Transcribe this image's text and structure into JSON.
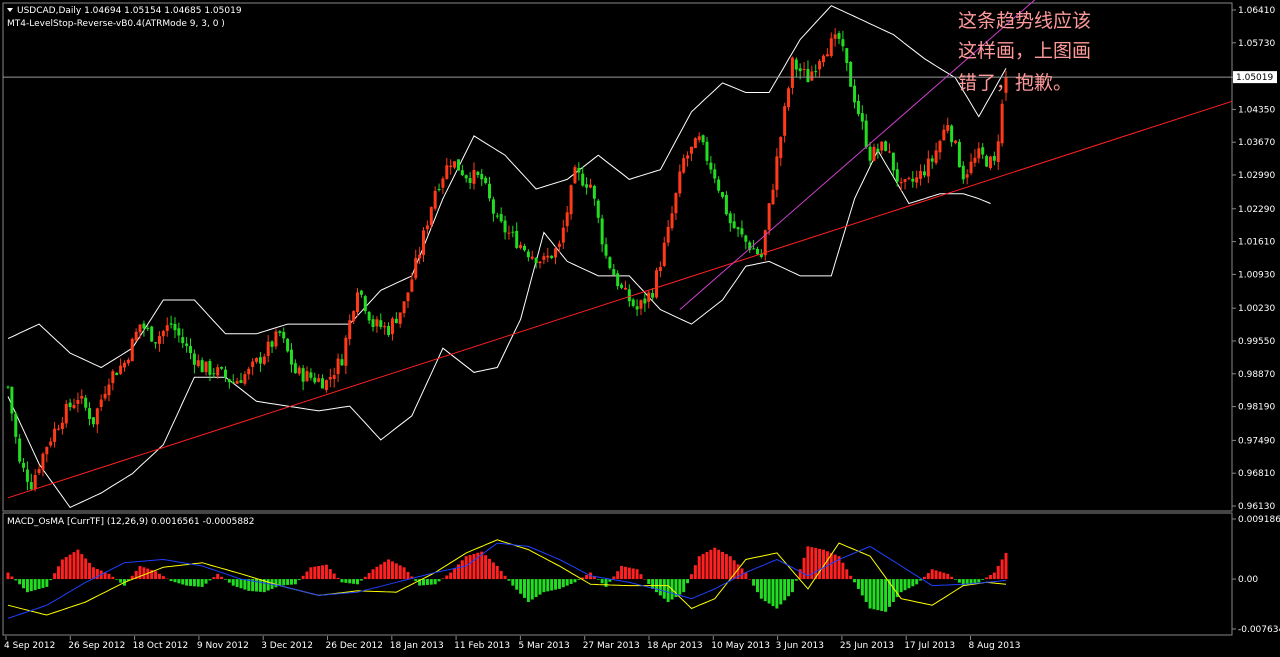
{
  "main_header": {
    "symbol_info": "USDCAD,Daily  1.04694 1.05154 1.04685 1.05019",
    "indicator_label": "MT4-LevelStop-Reverse-vB0.4(ATRMode 9, 3, 0 )"
  },
  "annotation": {
    "lines": [
      "这条趋势线应该",
      "这样画，上图画",
      "错了，抱歉。"
    ]
  },
  "macd_header": {
    "label": "MACD_OsMA [CurrTF] (12,26,9) 0.0016561 -0.0005882"
  },
  "colors": {
    "background": "#000000",
    "grid": "#ffffff",
    "bull_candle": "#ff3a1a",
    "bear_candle": "#22dd22",
    "bollinger": "#ffffff",
    "trendline_red": "#ff2020",
    "trendline_magenta": "#d040d0",
    "macd_pos": "#ff2020",
    "macd_neg": "#22dd22",
    "signal_yellow": "#ffff00",
    "signal_blue": "#2040ff",
    "annotation": "#ff9a9a"
  },
  "chart_data": [
    {
      "type": "candlestick",
      "title": "USDCAD,Daily",
      "y_ticks": [
        "1.06410",
        "1.05730",
        "1.05019",
        "1.04350",
        "1.03670",
        "1.02990",
        "1.02290",
        "1.01610",
        "1.00930",
        "1.00230",
        "0.99550",
        "0.98870",
        "0.98190",
        "0.97490",
        "0.96810",
        "0.96130"
      ],
      "current_price": "1.05019",
      "ylim": [
        0.9613,
        1.0641
      ],
      "x_ticks": [
        "4 Sep 2012",
        "26 Sep 2012",
        "18 Oct 2012",
        "9 Nov 2012",
        "3 Dec 2012",
        "26 Dec 2012",
        "18 Jan 2013",
        "11 Feb 2013",
        "5 Mar 2013",
        "27 Mar 2013",
        "18 Apr 2013",
        "10 May 2013",
        "3 Jun 2013",
        "25 Jun 2013",
        "17 Jul 2013",
        "8 Aug 2013"
      ],
      "last_bar": {
        "open": 1.04694,
        "high": 1.05154,
        "low": 1.04685,
        "close": 1.05019
      },
      "price_path": [
        [
          0,
          0.986
        ],
        [
          3,
          0.97
        ],
        [
          6,
          0.966
        ],
        [
          10,
          0.974
        ],
        [
          14,
          0.98
        ],
        [
          18,
          0.984
        ],
        [
          22,
          0.979
        ],
        [
          26,
          0.988
        ],
        [
          30,
          0.991
        ],
        [
          34,
          0.999
        ],
        [
          38,
          0.996
        ],
        [
          42,
          0.999
        ],
        [
          46,
          0.994
        ],
        [
          50,
          0.99
        ],
        [
          54,
          0.989
        ],
        [
          58,
          0.987
        ],
        [
          62,
          0.989
        ],
        [
          66,
          0.993
        ],
        [
          70,
          0.997
        ],
        [
          74,
          0.989
        ],
        [
          78,
          0.988
        ],
        [
          82,
          0.987
        ],
        [
          86,
          0.992
        ],
        [
          90,
          1.007
        ],
        [
          94,
          0.999
        ],
        [
          98,
          0.998
        ],
        [
          102,
          1.003
        ],
        [
          106,
          1.014
        ],
        [
          110,
          1.027
        ],
        [
          114,
          1.033
        ],
        [
          118,
          1.03
        ],
        [
          122,
          1.029
        ],
        [
          126,
          1.02
        ],
        [
          130,
          1.017
        ],
        [
          134,
          1.014
        ],
        [
          138,
          1.012
        ],
        [
          142,
          1.015
        ],
        [
          146,
          1.03
        ],
        [
          150,
          1.028
        ],
        [
          154,
          1.013
        ],
        [
          158,
          1.006
        ],
        [
          162,
          1.002
        ],
        [
          166,
          1.006
        ],
        [
          170,
          1.018
        ],
        [
          174,
          1.033
        ],
        [
          178,
          1.037
        ],
        [
          182,
          1.03
        ],
        [
          186,
          1.02
        ],
        [
          190,
          1.016
        ],
        [
          194,
          1.013
        ],
        [
          198,
          1.033
        ],
        [
          202,
          1.053
        ],
        [
          206,
          1.05
        ],
        [
          210,
          1.056
        ],
        [
          214,
          1.058
        ],
        [
          218,
          1.046
        ],
        [
          222,
          1.034
        ],
        [
          226,
          1.036
        ],
        [
          230,
          1.027
        ],
        [
          234,
          1.029
        ],
        [
          238,
          1.033
        ],
        [
          242,
          1.041
        ],
        [
          246,
          1.03
        ],
        [
          250,
          1.034
        ],
        [
          254,
          1.032
        ],
        [
          257,
          1.0502
        ]
      ],
      "bollinger": {
        "upper": [
          [
            0,
            0.996
          ],
          [
            8,
            0.999
          ],
          [
            16,
            0.993
          ],
          [
            24,
            0.99
          ],
          [
            32,
            0.994
          ],
          [
            40,
            1.004
          ],
          [
            48,
            1.004
          ],
          [
            56,
            0.997
          ],
          [
            64,
            0.997
          ],
          [
            72,
            0.999
          ],
          [
            80,
            0.999
          ],
          [
            88,
            0.999
          ],
          [
            96,
            1.006
          ],
          [
            104,
            1.009
          ],
          [
            112,
            1.025
          ],
          [
            120,
            1.038
          ],
          [
            128,
            1.034
          ],
          [
            136,
            1.027
          ],
          [
            144,
            1.029
          ],
          [
            152,
            1.034
          ],
          [
            160,
            1.029
          ],
          [
            168,
            1.031
          ],
          [
            176,
            1.043
          ],
          [
            184,
            1.049
          ],
          [
            190,
            1.047
          ],
          [
            196,
            1.047
          ],
          [
            204,
            1.058
          ],
          [
            212,
            1.065
          ],
          [
            220,
            1.062
          ],
          [
            228,
            1.059
          ],
          [
            236,
            1.054
          ],
          [
            244,
            1.05
          ],
          [
            250,
            1.042
          ],
          [
            257,
            1.052
          ]
        ],
        "lower": [
          [
            0,
            0.984
          ],
          [
            8,
            0.97
          ],
          [
            16,
            0.961
          ],
          [
            24,
            0.964
          ],
          [
            32,
            0.968
          ],
          [
            40,
            0.974
          ],
          [
            48,
            0.988
          ],
          [
            56,
            0.988
          ],
          [
            64,
            0.983
          ],
          [
            72,
            0.982
          ],
          [
            80,
            0.981
          ],
          [
            88,
            0.982
          ],
          [
            96,
            0.975
          ],
          [
            104,
            0.98
          ],
          [
            112,
            0.994
          ],
          [
            120,
            0.989
          ],
          [
            126,
            0.99
          ],
          [
            132,
            1.0
          ],
          [
            138,
            1.018
          ],
          [
            144,
            1.012
          ],
          [
            152,
            1.009
          ],
          [
            160,
            1.009
          ],
          [
            168,
            1.002
          ],
          [
            176,
            0.999
          ],
          [
            184,
            1.004
          ],
          [
            190,
            1.011
          ],
          [
            196,
            1.012
          ],
          [
            204,
            1.009
          ],
          [
            212,
            1.009
          ],
          [
            218,
            1.025
          ],
          [
            224,
            1.035
          ],
          [
            232,
            1.024
          ],
          [
            240,
            1.026
          ],
          [
            246,
            1.026
          ],
          [
            250,
            1.025
          ],
          [
            253,
            1.024
          ]
        ]
      },
      "trendlines": [
        {
          "color": "red",
          "from": [
            0,
            0.963
          ],
          "to": [
            257,
            1.03
          ]
        },
        {
          "color": "magenta",
          "from": [
            173,
            1.002
          ],
          "to": [
            257,
            1.061
          ]
        }
      ]
    },
    {
      "type": "histogram+lines",
      "title": "MACD_OsMA [CurrTF] (12,26,9)",
      "values_printed": [
        0.0016561,
        -0.0005882
      ],
      "y_ticks": [
        "0.0091864",
        "0.00",
        "-0.007634"
      ],
      "ylim": [
        -0.007634,
        0.0091864
      ],
      "histogram": [
        [
          0,
          0.001
        ],
        [
          5,
          -0.002
        ],
        [
          10,
          -0.0012
        ],
        [
          14,
          0.003
        ],
        [
          18,
          0.0045
        ],
        [
          22,
          0.0018
        ],
        [
          26,
          0.0008
        ],
        [
          30,
          -0.001
        ],
        [
          34,
          0.002
        ],
        [
          38,
          0.0012
        ],
        [
          42,
          -0.0003
        ],
        [
          46,
          -0.001
        ],
        [
          50,
          -0.0012
        ],
        [
          54,
          0.0008
        ],
        [
          58,
          -0.001
        ],
        [
          62,
          -0.0018
        ],
        [
          66,
          -0.002
        ],
        [
          70,
          -0.001
        ],
        [
          74,
          -0.0008
        ],
        [
          78,
          0.0018
        ],
        [
          82,
          0.0022
        ],
        [
          86,
          -0.0005
        ],
        [
          90,
          -0.0008
        ],
        [
          94,
          0.0015
        ],
        [
          98,
          0.003
        ],
        [
          102,
          0.0018
        ],
        [
          106,
          -0.001
        ],
        [
          110,
          -0.0008
        ],
        [
          114,
          0.001
        ],
        [
          118,
          0.0035
        ],
        [
          122,
          0.0042
        ],
        [
          126,
          0.002
        ],
        [
          130,
          -0.001
        ],
        [
          134,
          -0.0035
        ],
        [
          138,
          -0.002
        ],
        [
          142,
          -0.0015
        ],
        [
          146,
          -0.0005
        ],
        [
          150,
          0.001
        ],
        [
          154,
          -0.0012
        ],
        [
          158,
          0.002
        ],
        [
          162,
          0.0015
        ],
        [
          166,
          -0.0015
        ],
        [
          170,
          -0.0035
        ],
        [
          174,
          -0.002
        ],
        [
          178,
          0.0035
        ],
        [
          182,
          0.0048
        ],
        [
          186,
          0.0035
        ],
        [
          190,
          0.001
        ],
        [
          194,
          -0.003
        ],
        [
          198,
          -0.0045
        ],
        [
          202,
          -0.002
        ],
        [
          206,
          0.005
        ],
        [
          210,
          0.0045
        ],
        [
          214,
          0.0035
        ],
        [
          218,
          -0.0005
        ],
        [
          222,
          -0.0045
        ],
        [
          226,
          -0.005
        ],
        [
          230,
          -0.002
        ],
        [
          234,
          -0.0008
        ],
        [
          238,
          0.0015
        ],
        [
          242,
          0.0008
        ],
        [
          246,
          -0.001
        ],
        [
          250,
          -0.0005
        ],
        [
          254,
          0.001
        ],
        [
          257,
          0.004
        ]
      ],
      "series": [
        {
          "color": "yellow",
          "values": [
            [
              0,
              -0.004
            ],
            [
              10,
              -0.0055
            ],
            [
              20,
              -0.0035
            ],
            [
              30,
              -0.0005
            ],
            [
              40,
              0.0018
            ],
            [
              50,
              0.0025
            ],
            [
              60,
              0.0008
            ],
            [
              70,
              -0.001
            ],
            [
              80,
              -0.0025
            ],
            [
              90,
              -0.0018
            ],
            [
              100,
              -0.002
            ],
            [
              110,
              0.001
            ],
            [
              118,
              0.004
            ],
            [
              126,
              0.006
            ],
            [
              134,
              0.0045
            ],
            [
              142,
              0.002
            ],
            [
              150,
              -0.0008
            ],
            [
              160,
              -0.001
            ],
            [
              170,
              -0.001
            ],
            [
              176,
              -0.0045
            ],
            [
              182,
              -0.003
            ],
            [
              190,
              0.003
            ],
            [
              198,
              0.004
            ],
            [
              206,
              -0.0015
            ],
            [
              214,
              0.0055
            ],
            [
              222,
              0.0035
            ],
            [
              230,
              -0.003
            ],
            [
              238,
              -0.004
            ],
            [
              246,
              -0.001
            ],
            [
              252,
              -0.0005
            ],
            [
              257,
              -0.0008
            ]
          ]
        },
        {
          "color": "blue",
          "values": [
            [
              0,
              -0.006
            ],
            [
              10,
              -0.004
            ],
            [
              20,
              -0.0005
            ],
            [
              30,
              0.0025
            ],
            [
              40,
              0.003
            ],
            [
              50,
              0.002
            ],
            [
              60,
              0.0
            ],
            [
              70,
              -0.001
            ],
            [
              80,
              -0.0025
            ],
            [
              90,
              -0.002
            ],
            [
              100,
              -0.0005
            ],
            [
              110,
              0.001
            ],
            [
              118,
              0.002
            ],
            [
              126,
              0.0055
            ],
            [
              134,
              0.005
            ],
            [
              142,
              0.003
            ],
            [
              150,
              0.0005
            ],
            [
              160,
              -0.0005
            ],
            [
              170,
              -0.002
            ],
            [
              176,
              -0.003
            ],
            [
              182,
              -0.0015
            ],
            [
              190,
              0.001
            ],
            [
              198,
              0.003
            ],
            [
              206,
              0.0005
            ],
            [
              214,
              0.003
            ],
            [
              222,
              0.005
            ],
            [
              230,
              0.002
            ],
            [
              238,
              -0.001
            ],
            [
              246,
              -0.0008
            ],
            [
              252,
              -0.0005
            ],
            [
              257,
              -0.0002
            ]
          ]
        }
      ]
    }
  ]
}
